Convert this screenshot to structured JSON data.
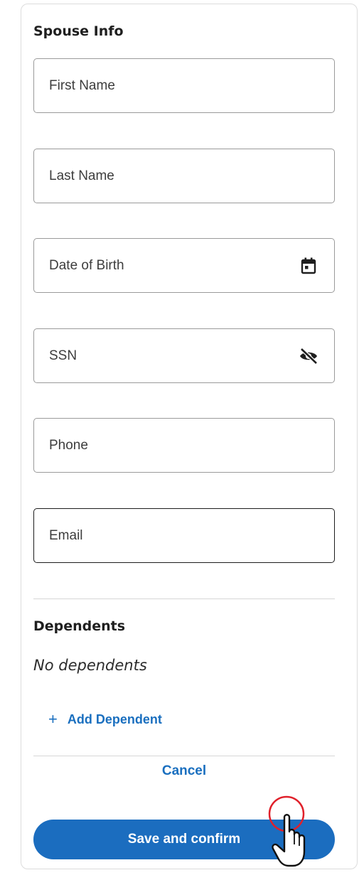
{
  "spouse": {
    "title": "Spouse Info",
    "fields": {
      "first_name": {
        "placeholder": "First Name",
        "value": ""
      },
      "last_name": {
        "placeholder": "Last Name",
        "value": ""
      },
      "dob": {
        "placeholder": "Date of Birth",
        "value": "",
        "icon": "calendar-icon"
      },
      "ssn": {
        "placeholder": "SSN",
        "value": "",
        "icon": "eye-off-icon"
      },
      "phone": {
        "placeholder": "Phone",
        "value": ""
      },
      "email": {
        "placeholder": "Email",
        "value": ""
      }
    }
  },
  "dependents": {
    "title": "Dependents",
    "empty_text": "No dependents",
    "add_label": "Add Dependent",
    "add_icon": "+"
  },
  "actions": {
    "cancel_label": "Cancel",
    "save_label": "Save and confirm"
  },
  "colors": {
    "accent": "#1b6dbf",
    "link": "#1a6fbf",
    "cursor_ring": "#e0202a"
  }
}
